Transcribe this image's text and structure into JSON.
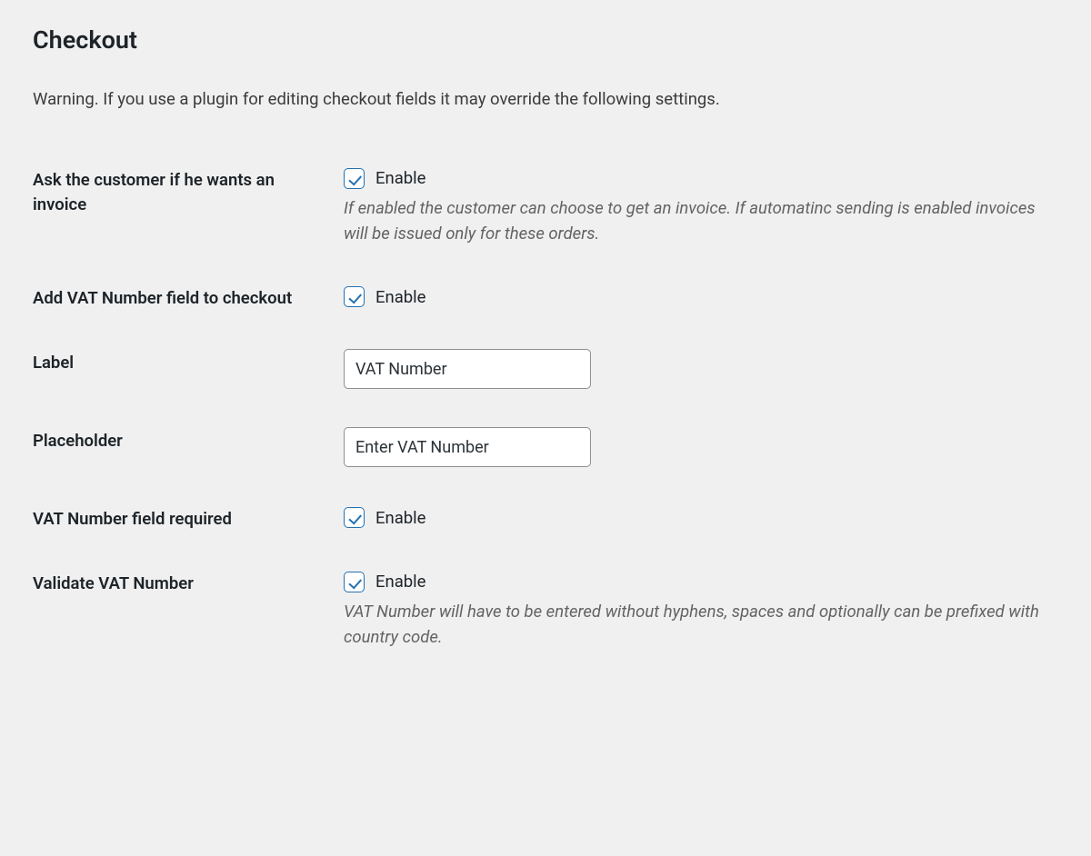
{
  "page": {
    "title": "Checkout",
    "warning": "Warning. If you use a plugin for editing checkout fields it may override the following settings."
  },
  "common": {
    "enable_label": "Enable"
  },
  "rows": {
    "ask_invoice": {
      "label": "Ask the customer if he wants an invoice",
      "checked": true,
      "help": "If enabled the customer can choose to get an invoice. If automatinc sending is enabled invoices will be issued only for these orders."
    },
    "add_vat": {
      "label": "Add VAT Number field to checkout",
      "checked": true
    },
    "vat_label": {
      "label": "Label",
      "value": "VAT Number"
    },
    "vat_placeholder": {
      "label": "Placeholder",
      "value": "Enter VAT Number"
    },
    "vat_required": {
      "label": "VAT Number field required",
      "checked": true
    },
    "validate_vat": {
      "label": "Validate VAT Number",
      "checked": true,
      "help": "VAT Number will have to be entered without hyphens, spaces and optionally can be prefixed with country code."
    }
  }
}
